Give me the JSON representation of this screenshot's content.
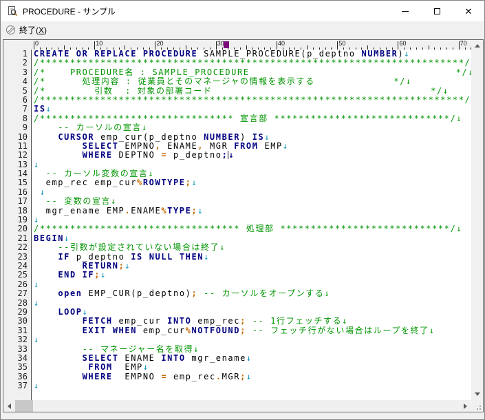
{
  "window": {
    "title": "PROCEDURE - サンプル",
    "controls": {
      "minimize": "minimize",
      "maximize": "maximize",
      "close": "close"
    }
  },
  "toolbar": {
    "exit": {
      "pre": "終了(",
      "mnemonic": "X",
      "post": ")"
    }
  },
  "ruler": {
    "labels": [
      0,
      10,
      20,
      30,
      40,
      50,
      60,
      70
    ],
    "max_col": 76,
    "marker_col": 32,
    "marker_color": "#7A0A7C"
  },
  "editor": {
    "colors": {
      "keyword": "#000080",
      "comment": "#009500",
      "operator": "#C06A00",
      "newline": "#0090B8",
      "plain": "#000000",
      "caret": "#000000"
    },
    "cursor": {
      "line": 12,
      "col": 32
    },
    "lines": [
      {
        "no": 1,
        "tokens": [
          [
            "k",
            "CREATE OR REPLACE PROCEDURE"
          ],
          [
            "p",
            " SAMPLE_PROCEDURE(p_deptno "
          ],
          [
            "k",
            "NUMBER"
          ],
          [
            "p",
            ")"
          ],
          [
            "n",
            "↓"
          ]
        ]
      },
      {
        "no": 2,
        "tokens": [
          [
            "c",
            "/**********************************************************************/↓"
          ]
        ]
      },
      {
        "no": 3,
        "tokens": [
          [
            "c",
            "/*    PROCEDURE名 : SAMPLE_PROCEDURE                                  */↓"
          ]
        ]
      },
      {
        "no": 4,
        "tokens": [
          [
            "c",
            "/*      処理内容 : 従業員とそのマネージャの情報を表示する             */↓"
          ]
        ]
      },
      {
        "no": 5,
        "tokens": [
          [
            "c",
            "/*        引数  : 対象の部署コード                                    */↓"
          ]
        ]
      },
      {
        "no": 6,
        "tokens": [
          [
            "c",
            "/**********************************************************************/↓"
          ]
        ]
      },
      {
        "no": 7,
        "tokens": [
          [
            "k",
            "IS"
          ],
          [
            "n",
            "↓"
          ]
        ]
      },
      {
        "no": 8,
        "tokens": [
          [
            "c",
            "/******************************** 宣言部 *****************************/↓"
          ]
        ]
      },
      {
        "no": 9,
        "tokens": [
          [
            "c",
            "    -- カーソルの宣言↓"
          ]
        ]
      },
      {
        "no": 10,
        "tokens": [
          [
            "p",
            "    "
          ],
          [
            "k",
            "CURSOR"
          ],
          [
            "p",
            " emp_cur(p_deptno "
          ],
          [
            "k",
            "NUMBER"
          ],
          [
            "p",
            ") "
          ],
          [
            "k",
            "IS"
          ],
          [
            "n",
            "↓"
          ]
        ]
      },
      {
        "no": 11,
        "tokens": [
          [
            "p",
            "        "
          ],
          [
            "k",
            "SELECT"
          ],
          [
            "p",
            " EMPNO"
          ],
          [
            "o",
            ","
          ],
          [
            "p",
            " ENAME"
          ],
          [
            "o",
            ","
          ],
          [
            "p",
            " MGR "
          ],
          [
            "k",
            "FROM"
          ],
          [
            "p",
            " EMP"
          ],
          [
            "n",
            "↓"
          ]
        ]
      },
      {
        "no": 12,
        "tokens": [
          [
            "p",
            "        "
          ],
          [
            "k",
            "WHERE"
          ],
          [
            "p",
            " DEPTNO "
          ],
          [
            "o",
            "="
          ],
          [
            "p",
            " p_deptno"
          ],
          [
            "b",
            ";"
          ],
          [
            "t",
            ""
          ],
          [
            "b",
            "↓"
          ]
        ]
      },
      {
        "no": 13,
        "tokens": [
          [
            "n",
            "↓"
          ]
        ]
      },
      {
        "no": 14,
        "tokens": [
          [
            "c",
            "  -- カーソル変数の宣言↓"
          ]
        ]
      },
      {
        "no": 15,
        "tokens": [
          [
            "p",
            "  emp_rec emp_cur"
          ],
          [
            "o",
            "%"
          ],
          [
            "k",
            "ROWTYPE"
          ],
          [
            "o",
            ";"
          ],
          [
            "n",
            "↓"
          ]
        ]
      },
      {
        "no": 16,
        "tokens": [
          [
            "p",
            " "
          ],
          [
            "n",
            "↓"
          ]
        ]
      },
      {
        "no": 17,
        "tokens": [
          [
            "c",
            "  -- 変数の宣言↓"
          ]
        ]
      },
      {
        "no": 18,
        "tokens": [
          [
            "p",
            "  mgr_ename EMP"
          ],
          [
            "o",
            "."
          ],
          [
            "p",
            "ENAME"
          ],
          [
            "o",
            "%"
          ],
          [
            "k",
            "TYPE"
          ],
          [
            "o",
            ";"
          ],
          [
            "n",
            "↓"
          ]
        ]
      },
      {
        "no": 19,
        "tokens": [
          [
            "n",
            "↓"
          ]
        ]
      },
      {
        "no": 20,
        "tokens": [
          [
            "c",
            "/********************************* 処理部 ****************************/↓"
          ]
        ]
      },
      {
        "no": 21,
        "tokens": [
          [
            "k",
            "BEGIN"
          ],
          [
            "n",
            "↓"
          ]
        ]
      },
      {
        "no": 22,
        "tokens": [
          [
            "c",
            "    --引数が設定されていない場合は終了↓"
          ]
        ]
      },
      {
        "no": 23,
        "tokens": [
          [
            "p",
            "    "
          ],
          [
            "k",
            "IF"
          ],
          [
            "p",
            " p_deptno "
          ],
          [
            "k",
            "IS NULL THEN"
          ],
          [
            "n",
            "↓"
          ]
        ]
      },
      {
        "no": 24,
        "tokens": [
          [
            "p",
            "        "
          ],
          [
            "k",
            "RETURN"
          ],
          [
            "o",
            ";"
          ],
          [
            "n",
            "↓"
          ]
        ]
      },
      {
        "no": 25,
        "tokens": [
          [
            "p",
            "    "
          ],
          [
            "k",
            "END IF"
          ],
          [
            "o",
            ";"
          ],
          [
            "n",
            "↓"
          ]
        ]
      },
      {
        "no": 26,
        "tokens": [
          [
            "n",
            "↓"
          ]
        ]
      },
      {
        "no": 27,
        "tokens": [
          [
            "p",
            "    "
          ],
          [
            "k",
            "open"
          ],
          [
            "p",
            " EMP_CUR(p_deptno)"
          ],
          [
            "o",
            ";"
          ],
          [
            "p",
            " "
          ],
          [
            "c",
            "-- カーソルをオープンする↓"
          ]
        ]
      },
      {
        "no": 28,
        "tokens": [
          [
            "n",
            "↓"
          ]
        ]
      },
      {
        "no": 29,
        "tokens": [
          [
            "p",
            "    "
          ],
          [
            "k",
            "LOOP"
          ],
          [
            "n",
            "↓"
          ]
        ]
      },
      {
        "no": 30,
        "tokens": [
          [
            "p",
            "        "
          ],
          [
            "k",
            "FETCH"
          ],
          [
            "p",
            " emp_cur "
          ],
          [
            "k",
            "INTO"
          ],
          [
            "p",
            " emp_rec"
          ],
          [
            "o",
            ";"
          ],
          [
            "p",
            " "
          ],
          [
            "c",
            "-- 1行フェッチする↓"
          ]
        ]
      },
      {
        "no": 31,
        "tokens": [
          [
            "p",
            "        "
          ],
          [
            "k",
            "EXIT WHEN"
          ],
          [
            "p",
            " emp_cur"
          ],
          [
            "o",
            "%"
          ],
          [
            "k",
            "NOTFOUND"
          ],
          [
            "o",
            ";"
          ],
          [
            "p",
            " "
          ],
          [
            "c",
            "-- フェッチ行がない場合はループを終了↓"
          ]
        ]
      },
      {
        "no": 32,
        "tokens": [
          [
            "n",
            "↓"
          ]
        ]
      },
      {
        "no": 33,
        "tokens": [
          [
            "c",
            "        -- マネージャー名を取得↓"
          ]
        ]
      },
      {
        "no": 34,
        "tokens": [
          [
            "p",
            "        "
          ],
          [
            "k",
            "SELECT"
          ],
          [
            "p",
            " ENAME "
          ],
          [
            "k",
            "INTO"
          ],
          [
            "p",
            " mgr_ename"
          ],
          [
            "n",
            "↓"
          ]
        ]
      },
      {
        "no": 35,
        "tokens": [
          [
            "p",
            "         "
          ],
          [
            "k",
            "FROM"
          ],
          [
            "p",
            "  EMP"
          ],
          [
            "n",
            "↓"
          ]
        ]
      },
      {
        "no": 36,
        "tokens": [
          [
            "p",
            "        "
          ],
          [
            "k",
            "WHERE"
          ],
          [
            "p",
            "  EMPNO "
          ],
          [
            "o",
            "="
          ],
          [
            "p",
            " emp_rec"
          ],
          [
            "o",
            "."
          ],
          [
            "p",
            "MGR"
          ],
          [
            "o",
            ";"
          ],
          [
            "n",
            "↓"
          ]
        ]
      },
      {
        "no": 37,
        "tokens": [
          [
            "n",
            "↓"
          ]
        ]
      }
    ]
  }
}
